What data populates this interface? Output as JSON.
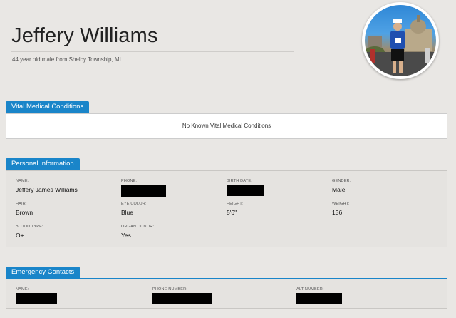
{
  "profile": {
    "name": "Jeffery Williams",
    "subtitle": "44 year old male from Shelby Township, MI",
    "photo": "runner-profile-photo"
  },
  "vital": {
    "title": "Vital Medical Conditions",
    "text": "No Known Vital Medical Conditions"
  },
  "personal": {
    "title": "Personal Information",
    "fields": [
      {
        "label": "NAME:",
        "value": "Jeffery James Williams"
      },
      {
        "label": "PHONE:",
        "value": "",
        "redacted": true
      },
      {
        "label": "BIRTH DATE:",
        "value": "",
        "redacted": true
      },
      {
        "label": "GENDER:",
        "value": "Male"
      },
      {
        "label": "HAIR:",
        "value": "Brown"
      },
      {
        "label": "EYE COLOR:",
        "value": "Blue"
      },
      {
        "label": "HEIGHT:",
        "value": "5'6\""
      },
      {
        "label": "WEIGHT:",
        "value": "136"
      },
      {
        "label": "BLOOD TYPE:",
        "value": "O+"
      },
      {
        "label": "ORGAN DONOR:",
        "value": "Yes"
      }
    ]
  },
  "emergency": {
    "title": "Emergency Contacts",
    "fields": [
      {
        "label": "NAME:",
        "redacted": true
      },
      {
        "label": "PHONE NUMBER:",
        "redacted": true
      },
      {
        "label": "ALT NUMBER:",
        "redacted": true
      }
    ]
  },
  "colors": {
    "accent": "#1a85c9",
    "background": "#e9e7e4",
    "panel": "#ffffff",
    "panel_gray": "#e5e3e0",
    "redaction": "#000000"
  }
}
